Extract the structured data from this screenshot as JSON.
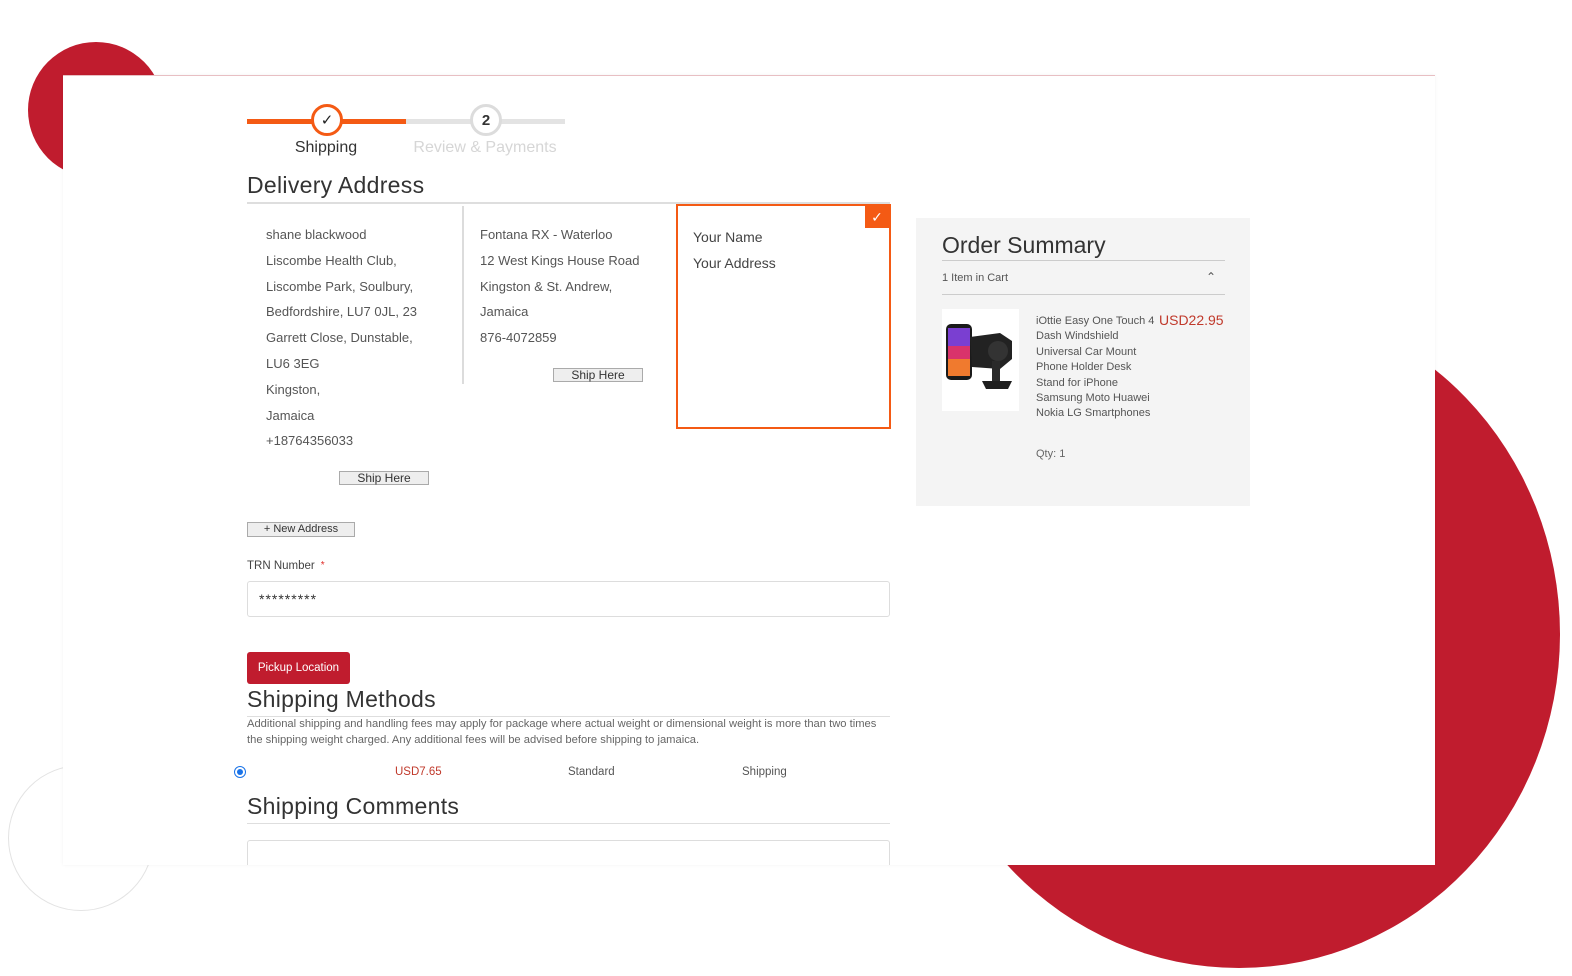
{
  "progress": {
    "steps": [
      {
        "number": "✓",
        "label": "Shipping"
      },
      {
        "number": "2",
        "label": "Review & Payments"
      }
    ]
  },
  "delivery": {
    "title": "Delivery Address",
    "addresses": [
      {
        "lines": [
          "shane blackwood",
          "Liscombe Health Club,",
          "Liscombe Park, Soulbury,",
          "Bedfordshire, LU7 0JL, 23",
          "Garrett Close, Dunstable,",
          "LU6 3EG",
          "Kingston,",
          "Jamaica",
          "+18764356033"
        ],
        "button_label": "Ship Here"
      },
      {
        "lines": [
          "Fontana RX - Waterloo",
          "12 West Kings House Road",
          "Kingston & St. Andrew,",
          "Jamaica",
          "876-4072859"
        ],
        "button_label": "Ship Here"
      }
    ],
    "selected": {
      "name": "Your Name",
      "address": "Your Address",
      "check_icon": "checkmark-icon"
    },
    "new_address_label": "+ New Address"
  },
  "trn": {
    "label": "TRN Number",
    "required_mark": "*",
    "value": "*********"
  },
  "pickup_label": "Pickup Location",
  "shipping_methods": {
    "title": "Shipping Methods",
    "note": "Additional shipping and handling fees may apply for package where actual weight or dimensional weight is more than two times the shipping weight charged. Any additional fees will be advised before shipping to jamaica.",
    "rate": {
      "price": "USD7.65",
      "method": "Standard",
      "carrier": "Shipping",
      "selected": true
    }
  },
  "comments": {
    "title": "Shipping Comments"
  },
  "summary": {
    "title": "Order Summary",
    "items_in_cart": "1 Item in Cart",
    "toggle_icon": "chevron-up-icon",
    "product": {
      "name": "iOttie Easy One Touch 4 Dash Windshield Universal Car Mount Phone Holder Desk Stand for iPhone Samsung Moto Huawei Nokia LG Smartphones",
      "price": "USD22.95",
      "qty": "Qty: 1"
    }
  },
  "colors": {
    "accent": "#f45a14",
    "brand_red": "#c01c2e",
    "price_red": "#c0392b"
  }
}
